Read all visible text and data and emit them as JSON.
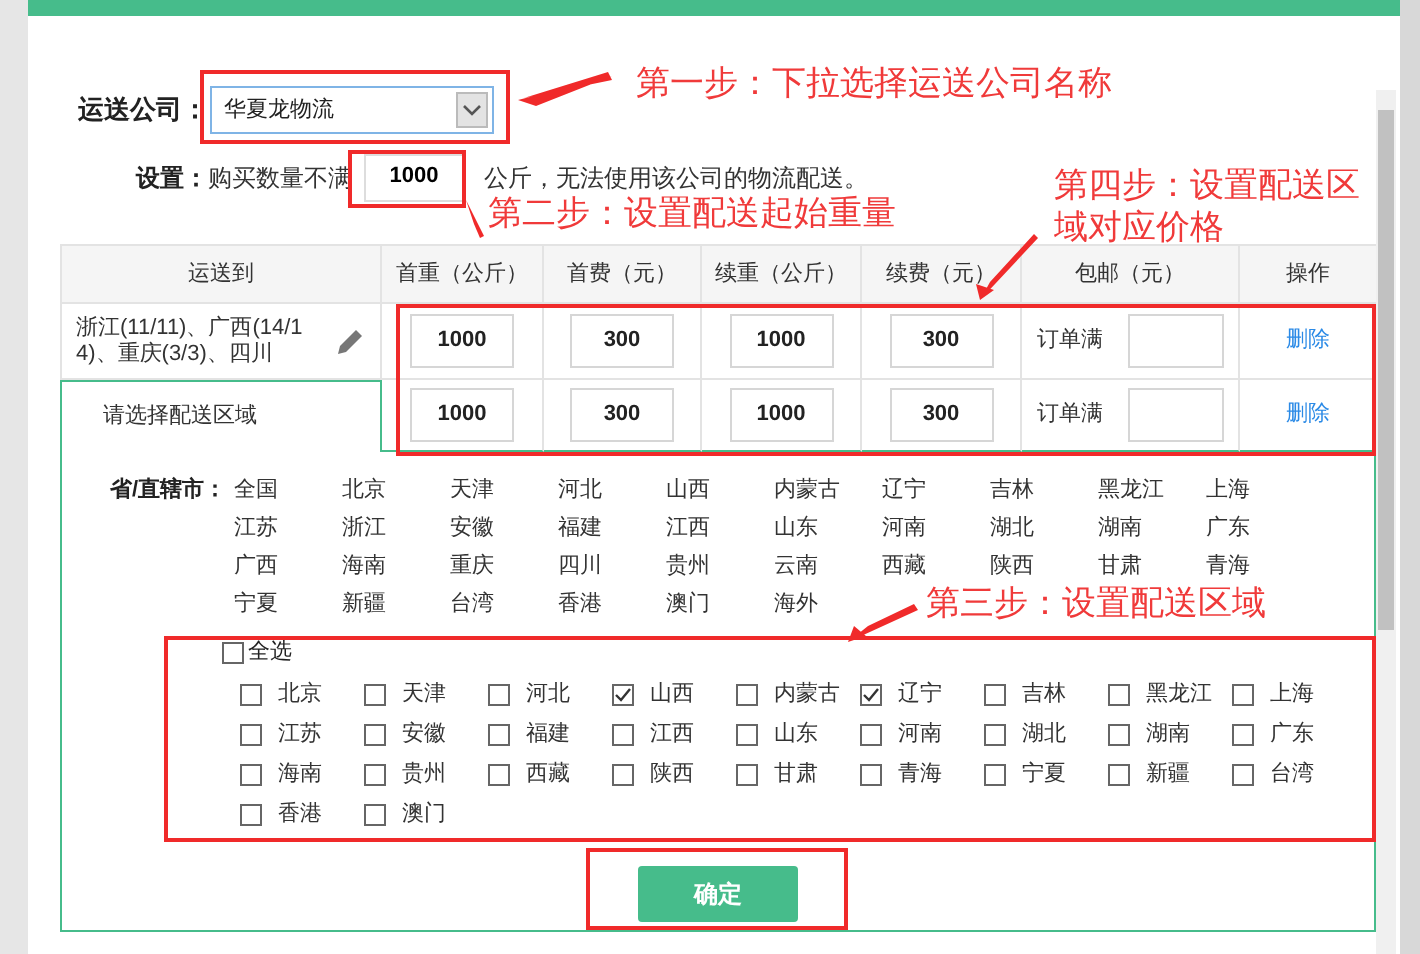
{
  "company": {
    "label": "运送公司：",
    "value": "华夏龙物流"
  },
  "setting": {
    "label": "设置：",
    "prefix": "购买数量不满",
    "value": "1000",
    "suffix": "公斤，无法使用该公司的物流配送。"
  },
  "table": {
    "columns": [
      "运送到",
      "首重（公斤）",
      "首费（元）",
      "续重（公斤）",
      "续费（元）",
      "包邮（元）",
      "操作"
    ],
    "rows": [
      {
        "destination": "浙江(11/11)、广西(14/14)、重庆(3/3)、四川",
        "editable": true,
        "selected": false,
        "first_weight": "1000",
        "first_fee": "300",
        "extra_weight": "1000",
        "extra_fee": "300",
        "free_label": "订单满",
        "action": "删除"
      },
      {
        "destination": "请选择配送区域",
        "editable": false,
        "selected": true,
        "first_weight": "1000",
        "first_fee": "300",
        "extra_weight": "1000",
        "extra_fee": "300",
        "free_label": "订单满",
        "action": "删除"
      }
    ]
  },
  "regions": {
    "label": "省/直辖市：",
    "items": [
      "全国",
      "北京",
      "天津",
      "河北",
      "山西",
      "内蒙古",
      "辽宁",
      "吉林",
      "黑龙江",
      "上海",
      "江苏",
      "浙江",
      "安徽",
      "福建",
      "江西",
      "山东",
      "河南",
      "湖北",
      "湖南",
      "广东",
      "广西",
      "海南",
      "重庆",
      "四川",
      "贵州",
      "云南",
      "西藏",
      "陕西",
      "甘肃",
      "青海",
      "宁夏",
      "新疆",
      "台湾",
      "香港",
      "澳门",
      "海外"
    ]
  },
  "checklist": {
    "select_all": {
      "label": "全选",
      "checked": false
    },
    "items": [
      {
        "label": "北京",
        "checked": false
      },
      {
        "label": "天津",
        "checked": false
      },
      {
        "label": "河北",
        "checked": false
      },
      {
        "label": "山西",
        "checked": true
      },
      {
        "label": "内蒙古",
        "checked": false
      },
      {
        "label": "辽宁",
        "checked": true
      },
      {
        "label": "吉林",
        "checked": false
      },
      {
        "label": "黑龙江",
        "checked": false
      },
      {
        "label": "上海",
        "checked": false
      },
      {
        "label": "江苏",
        "checked": false
      },
      {
        "label": "安徽",
        "checked": false
      },
      {
        "label": "福建",
        "checked": false
      },
      {
        "label": "江西",
        "checked": false
      },
      {
        "label": "山东",
        "checked": false
      },
      {
        "label": "河南",
        "checked": false
      },
      {
        "label": "湖北",
        "checked": false
      },
      {
        "label": "湖南",
        "checked": false
      },
      {
        "label": "广东",
        "checked": false
      },
      {
        "label": "海南",
        "checked": false
      },
      {
        "label": "贵州",
        "checked": false
      },
      {
        "label": "西藏",
        "checked": false
      },
      {
        "label": "陕西",
        "checked": false
      },
      {
        "label": "甘肃",
        "checked": false
      },
      {
        "label": "青海",
        "checked": false
      },
      {
        "label": "宁夏",
        "checked": false
      },
      {
        "label": "新疆",
        "checked": false
      },
      {
        "label": "台湾",
        "checked": false
      },
      {
        "label": "香港",
        "checked": false
      },
      {
        "label": "澳门",
        "checked": false
      }
    ]
  },
  "confirm_button": "确定",
  "annotations": [
    "第一步：下拉选择运送公司名称",
    "第二步：设置配送起始重量",
    "第四步：设置配送区域对应价格",
    "第三步：设置配送区域"
  ]
}
